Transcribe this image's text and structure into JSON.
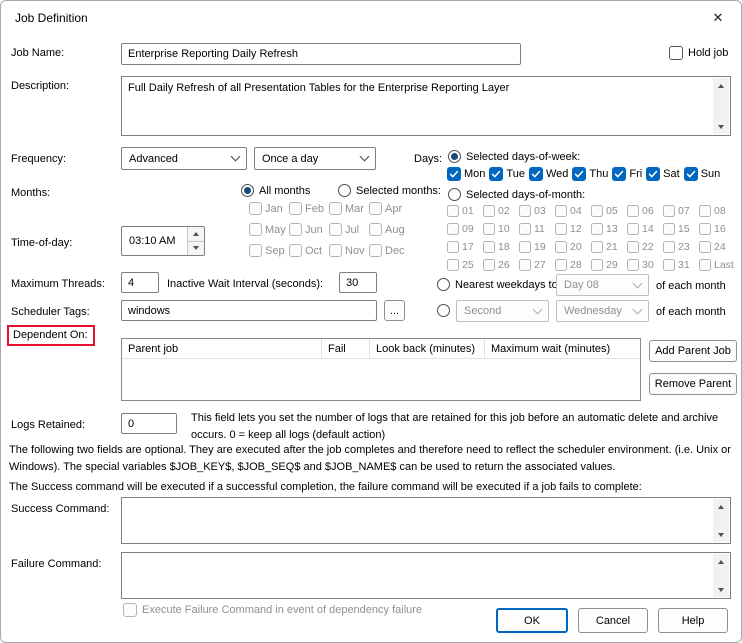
{
  "colors": {
    "accent": "#0067c0",
    "radio_fill": "#174a7c",
    "annotation_red": "#e8112d",
    "disabled_text": "#8f8f8f"
  },
  "dialog": {
    "title": "Job Definition",
    "close_icon": "✕"
  },
  "fields": {
    "job_name": {
      "label": "Job Name:",
      "value": "Enterprise Reporting Daily Refresh"
    },
    "hold_job": {
      "label": "Hold job"
    },
    "description": {
      "label": "Description:",
      "value": "Full Daily Refresh of all Presentation Tables for the Enterprise Reporting Layer"
    },
    "frequency": {
      "label": "Frequency:",
      "type_value": "Advanced",
      "interval_value": "Once a day"
    },
    "time_of_day": {
      "label": "Time-of-day:",
      "value": "03:10 AM"
    },
    "maximum_threads": {
      "label": "Maximum Threads:",
      "value": "4"
    },
    "inactive_wait": {
      "label": "Inactive Wait Interval (seconds):",
      "value": "30"
    },
    "scheduler_tags": {
      "label": "Scheduler Tags:",
      "value": "windows",
      "browse_label": "..."
    },
    "logs_retained": {
      "label": "Logs Retained:",
      "value": "0",
      "help": "This field lets you set the number of logs that are retained for this job before an automatic delete and archive occurs. 0 = keep all logs (default action)"
    },
    "success_command": {
      "label": "Success Command:",
      "value": ""
    },
    "failure_command": {
      "label": "Failure Command:",
      "value": ""
    }
  },
  "days": {
    "label": "Days:",
    "selected_days_of_week": "Selected days-of-week:",
    "weekdays": [
      "Mon",
      "Tue",
      "Wed",
      "Thu",
      "Fri",
      "Sat",
      "Sun"
    ],
    "selected_days_of_month": "Selected days-of-month:",
    "days_of_month": [
      "01",
      "02",
      "03",
      "04",
      "05",
      "06",
      "07",
      "08",
      "09",
      "10",
      "11",
      "12",
      "13",
      "14",
      "15",
      "16",
      "17",
      "18",
      "19",
      "20",
      "21",
      "22",
      "23",
      "24",
      "25",
      "26",
      "27",
      "28",
      "29",
      "30",
      "31",
      "Last"
    ],
    "nearest_weekdays": {
      "label": "Nearest weekdays to",
      "day_value": "Day 08",
      "suffix": "of each month"
    },
    "ordinal_weekday": {
      "ordinal_value": "Second",
      "weekday_value": "Wednesday",
      "suffix": "of each month"
    }
  },
  "months": {
    "label": "Months:",
    "all_months": "All months",
    "selected_months": "Selected months:",
    "names": [
      "Jan",
      "Feb",
      "Mar",
      "Apr",
      "May",
      "Jun",
      "Jul",
      "Aug",
      "Sep",
      "Oct",
      "Nov",
      "Dec"
    ]
  },
  "dependent_on": {
    "label": "Dependent On:",
    "columns": [
      "Parent job",
      "Fail",
      "Look back (minutes)",
      "Maximum wait (minutes)"
    ],
    "add_button": "Add Parent Job",
    "remove_button": "Remove Parent"
  },
  "notes": {
    "optional_fields": "The following two fields are optional. They are executed after the job completes and therefore need to reflect the scheduler environment. (i.e. Unix or Windows). The special variables $JOB_KEY$, $JOB_SEQ$ and $JOB_NAME$ can be used to return the associated values.",
    "command_execution": "The Success command will be executed if a successful completion, the failure command will be executed if a job fails to complete:"
  },
  "dependency_failure": {
    "label": "Execute Failure Command in event of dependency failure"
  },
  "footer": {
    "ok": "OK",
    "cancel": "Cancel",
    "help": "Help"
  }
}
